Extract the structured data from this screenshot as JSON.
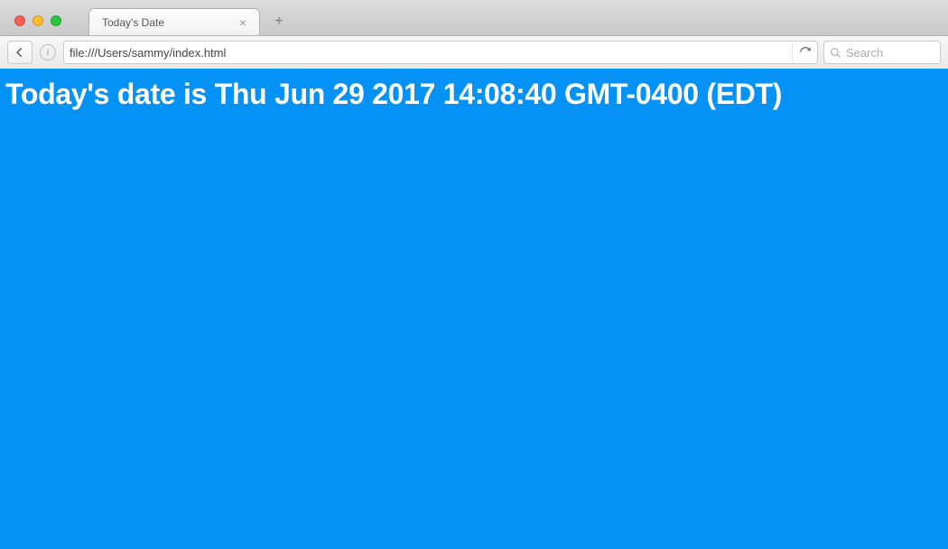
{
  "browser": {
    "tab_title": "Today's Date",
    "url": "file:///Users/sammy/index.html",
    "search_placeholder": "Search"
  },
  "page": {
    "heading": "Today's date is Thu Jun 29 2017 14:08:40 GMT-0400 (EDT)",
    "background_color": "#0492f7",
    "text_color": "#ffffff"
  }
}
